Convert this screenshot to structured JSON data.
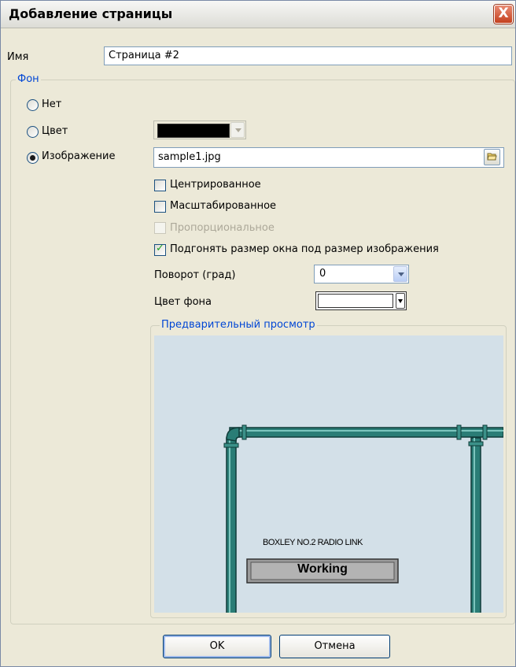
{
  "window": {
    "title": "Добавление страницы",
    "close_label": "X"
  },
  "name": {
    "label": "Имя",
    "value": "Страница #2"
  },
  "background": {
    "group_label": "Фон",
    "options": [
      {
        "label": "Нет",
        "checked": false
      },
      {
        "label": "Цвет",
        "checked": false
      },
      {
        "label": "Изображение",
        "checked": true
      }
    ],
    "color_value": "#000000",
    "image_file": "sample1.jpg",
    "checkboxes": [
      {
        "label": "Центрированное",
        "checked": false,
        "enabled": true
      },
      {
        "label": "Масштабированное",
        "checked": false,
        "enabled": true
      },
      {
        "label": "Пропорциональное",
        "checked": false,
        "enabled": false
      },
      {
        "label": "Подгонять размер окна под размер изображения",
        "checked": true,
        "enabled": true
      }
    ],
    "rotation": {
      "label": "Поворот (град)",
      "value": "0"
    },
    "bg_color": {
      "label": "Цвет фона",
      "value": "#FFFFFF"
    }
  },
  "preview": {
    "group_label": "Предварительный просмотр",
    "caption": "BOXLEY  NO.2 RADIO LINK",
    "status": "Working"
  },
  "buttons": {
    "ok": "OK",
    "cancel": "Отмена"
  }
}
